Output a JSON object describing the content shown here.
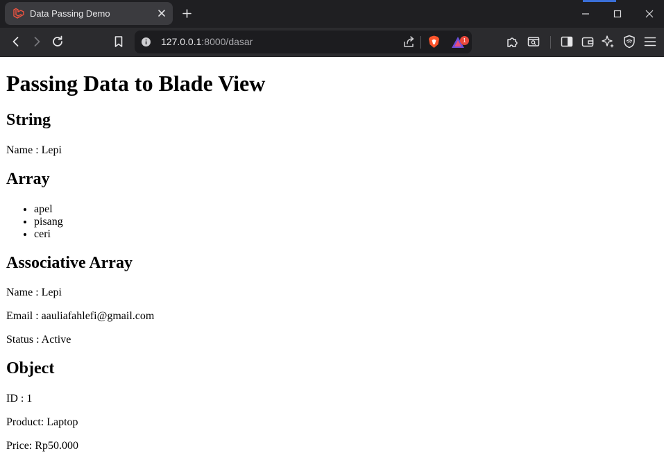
{
  "browser": {
    "tab_title": "Data Passing Demo",
    "url_host": "127.0.0.1",
    "url_rest": ":8000/dasar",
    "notification_count": "1",
    "accent_color": "#3a6fd8"
  },
  "page": {
    "title": "Passing Data to Blade View",
    "string_section": {
      "heading": "String",
      "name_line": "Name : Lepi"
    },
    "array_section": {
      "heading": "Array",
      "items": [
        "apel",
        "pisang",
        "ceri"
      ]
    },
    "assoc_section": {
      "heading": "Associative Array",
      "name_line": "Name : Lepi",
      "email_line": "Email : aauliafahlefi@gmail.com",
      "status_line": "Status : Active"
    },
    "object_section": {
      "heading": "Object",
      "id_line": "ID : 1",
      "product_line": "Product: Laptop",
      "price_line": "Price: Rp50.000"
    }
  }
}
